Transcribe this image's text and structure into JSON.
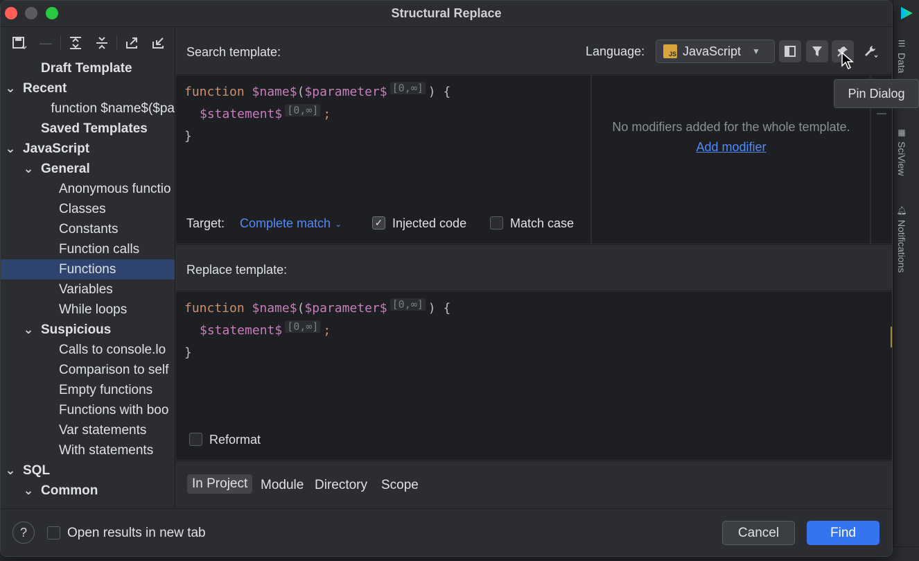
{
  "window": {
    "title": "Structural Replace"
  },
  "tree": {
    "items": [
      {
        "label": "Draft Template",
        "level": 1,
        "bold": true,
        "chevron": ""
      },
      {
        "label": "Recent",
        "level": 0,
        "bold": true,
        "chevron": "v"
      },
      {
        "label": "function $name$($pa",
        "level": 2,
        "bold": false,
        "chevron": ""
      },
      {
        "label": "Saved Templates",
        "level": 1,
        "bold": true,
        "chevron": ""
      },
      {
        "label": "JavaScript",
        "level": 0,
        "bold": true,
        "chevron": "v"
      },
      {
        "label": "General",
        "level": 1,
        "bold": true,
        "chevron": "v"
      },
      {
        "label": "Anonymous functio",
        "level": 2,
        "bold": false,
        "chevron": ""
      },
      {
        "label": "Classes",
        "level": 2,
        "bold": false,
        "chevron": ""
      },
      {
        "label": "Constants",
        "level": 2,
        "bold": false,
        "chevron": ""
      },
      {
        "label": "Function calls",
        "level": 2,
        "bold": false,
        "chevron": ""
      },
      {
        "label": "Functions",
        "level": 2,
        "bold": false,
        "chevron": "",
        "selected": true
      },
      {
        "label": "Variables",
        "level": 2,
        "bold": false,
        "chevron": ""
      },
      {
        "label": "While loops",
        "level": 2,
        "bold": false,
        "chevron": ""
      },
      {
        "label": "Suspicious",
        "level": 1,
        "bold": true,
        "chevron": "v"
      },
      {
        "label": "Calls to console.lo",
        "level": 2,
        "bold": false,
        "chevron": ""
      },
      {
        "label": "Comparison to self",
        "level": 2,
        "bold": false,
        "chevron": ""
      },
      {
        "label": "Empty functions",
        "level": 2,
        "bold": false,
        "chevron": ""
      },
      {
        "label": "Functions with boo",
        "level": 2,
        "bold": false,
        "chevron": ""
      },
      {
        "label": "Var statements",
        "level": 2,
        "bold": false,
        "chevron": ""
      },
      {
        "label": "With statements",
        "level": 2,
        "bold": false,
        "chevron": ""
      },
      {
        "label": "SQL",
        "level": 0,
        "bold": true,
        "chevron": "v"
      },
      {
        "label": "Common",
        "level": 1,
        "bold": true,
        "chevron": "v"
      }
    ]
  },
  "search": {
    "label": "Search template:",
    "language_label": "Language:",
    "language_value": "JavaScript",
    "language_icon_text": "JS",
    "code": {
      "kw_function": "function",
      "name_var": "$name$",
      "open_paren": "(",
      "param_var": "$parameter$",
      "param_badge": "[0,∞]",
      "close": ") {",
      "stmt_var": "$statement$",
      "stmt_badge": "[0,∞]",
      "semicolon": ";",
      "close_brace": "}"
    },
    "modifiers_empty": "No modifiers added for the whole template.",
    "add_modifier": "Add modifier",
    "target_label": "Target:",
    "target_value": "Complete match",
    "injected_code_label": "Injected code",
    "injected_code_checked": true,
    "match_case_label": "Match case",
    "match_case_checked": false
  },
  "replace": {
    "label": "Replace template:",
    "reformat_label": "Reformat",
    "reformat_checked": false
  },
  "scope": {
    "in_project": "In Project",
    "module": "Module",
    "directory": "Directory",
    "scope": "Scope"
  },
  "footer": {
    "help": "?",
    "open_new_tab_label": "Open results in new tab",
    "cancel": "Cancel",
    "find": "Find"
  },
  "tooltip": {
    "text": "Pin Dialog"
  },
  "ide_side": {
    "data": "Data",
    "sciview": "SciView",
    "notifications": "Notifications"
  },
  "colors": {
    "accent": "#3574f0",
    "link": "#548af7",
    "selection": "#2e436e",
    "keyword": "#cf8e6d",
    "variable": "#c77dbb"
  }
}
